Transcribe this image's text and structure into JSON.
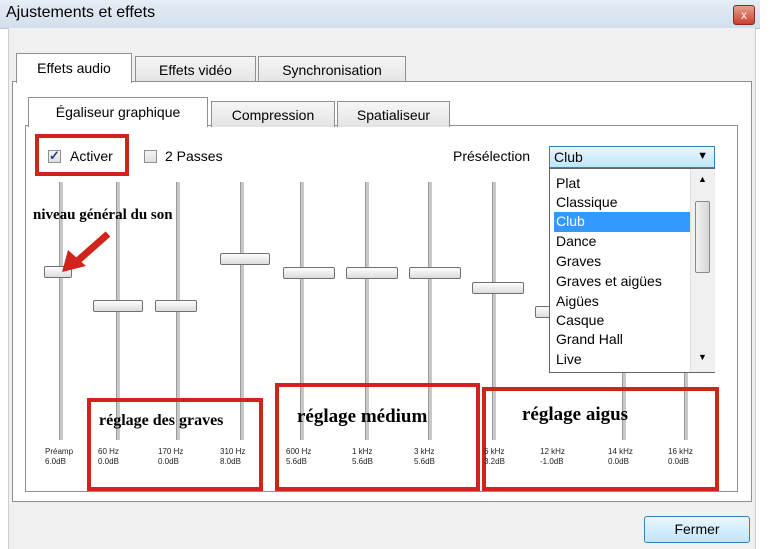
{
  "window": {
    "title": "Ajustements et effets",
    "close_glyph": "x"
  },
  "tabs": [
    {
      "label": "Effets audio"
    },
    {
      "label": "Effets vidéo"
    },
    {
      "label": "Synchronisation"
    }
  ],
  "subtabs": [
    {
      "label": "Égaliseur graphique"
    },
    {
      "label": "Compression"
    },
    {
      "label": "Spatialiseur"
    }
  ],
  "options": {
    "activer": {
      "label": "Activer",
      "checked": true
    },
    "two_pass": {
      "label": "2 Passes",
      "checked": false
    }
  },
  "preset": {
    "label": "Présélection",
    "selected": "Club",
    "options": [
      "Plat",
      "Classique",
      "Club",
      "Dance",
      "Graves",
      "Graves et aigües",
      "Aigües",
      "Casque",
      "Grand Hall",
      "Live"
    ]
  },
  "sliders": [
    {
      "freq": "Préamp",
      "value": "6.0dB"
    },
    {
      "freq": "60 Hz",
      "value": "0.0dB"
    },
    {
      "freq": "170 Hz",
      "value": "0.0dB"
    },
    {
      "freq": "310 Hz",
      "value": "8.0dB"
    },
    {
      "freq": "600 Hz",
      "value": "5.6dB"
    },
    {
      "freq": "1 kHz",
      "value": "5.6dB"
    },
    {
      "freq": "3 kHz",
      "value": "5.6dB"
    },
    {
      "freq": "6 kHz",
      "value": "3.2dB"
    },
    {
      "freq": "12 kHz",
      "value": "-1.0dB"
    },
    {
      "freq": "14 kHz",
      "value": "0.0dB"
    },
    {
      "freq": "16 kHz",
      "value": "0.0dB"
    }
  ],
  "annotations": {
    "niveau": "niveau général du son",
    "graves": "réglage des graves",
    "medium": "réglage médium",
    "aigus": "réglage aigus"
  },
  "buttons": {
    "close": "Fermer"
  },
  "colors": {
    "annotation_red": "#d0231b",
    "selection_blue": "#3399ff"
  }
}
